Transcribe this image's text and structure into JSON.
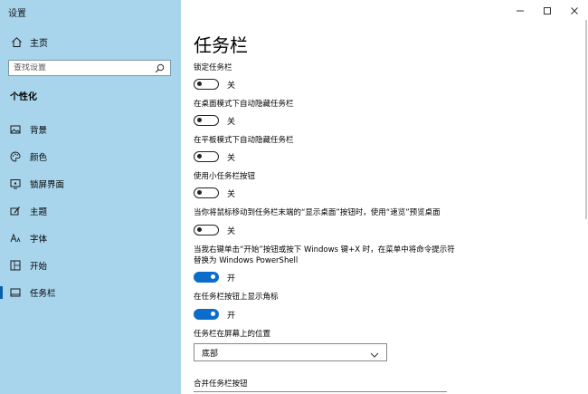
{
  "app_title": "设置",
  "nav_home": {
    "label": "主页",
    "icon": "home-icon"
  },
  "search": {
    "placeholder": "查找设置",
    "value": ""
  },
  "section_title": "个性化",
  "nav_items": [
    {
      "label": "背景",
      "icon": "image-icon",
      "active": false
    },
    {
      "label": "颜色",
      "icon": "palette-icon",
      "active": false
    },
    {
      "label": "锁屏界面",
      "icon": "lock-screen-icon",
      "active": false
    },
    {
      "label": "主题",
      "icon": "theme-brush-icon",
      "active": false
    },
    {
      "label": "字体",
      "icon": "font-icon",
      "active": false
    },
    {
      "label": "开始",
      "icon": "start-icon",
      "active": false
    },
    {
      "label": "任务栏",
      "icon": "taskbar-icon",
      "active": true
    }
  ],
  "page_title": "任务栏",
  "settings": [
    {
      "label": "锁定任务栏",
      "state": "关",
      "on": false
    },
    {
      "label": "在桌面模式下自动隐藏任务栏",
      "state": "关",
      "on": false
    },
    {
      "label": "在平板模式下自动隐藏任务栏",
      "state": "关",
      "on": false
    },
    {
      "label": "使用小任务栏按钮",
      "state": "关",
      "on": false
    },
    {
      "label": "当你将鼠标移动到任务栏末端的“显示桌面”按钮时，使用“速览”预览桌面",
      "state": "关",
      "on": false
    },
    {
      "label": "当我右键单击“开始”按钮或按下 Windows 键+X 时，在菜单中将命令提示符替换为 Windows PowerShell",
      "state": "开",
      "on": true
    },
    {
      "label": "在任务栏按钮上显示角标",
      "state": "开",
      "on": true
    }
  ],
  "position_label": "任务栏在屏幕上的位置",
  "position_value": "底部",
  "combine_label": "合并任务栏按钮",
  "colors": {
    "sidebar_bg": "#a8d4ec",
    "accent": "#0b6dc9"
  }
}
